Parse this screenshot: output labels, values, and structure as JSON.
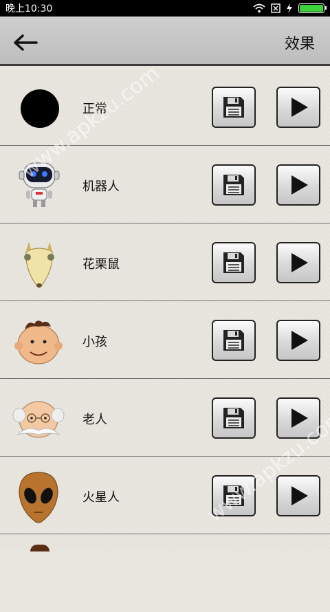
{
  "status_bar": {
    "time": "晚上10:30"
  },
  "toolbar": {
    "title": "效果"
  },
  "items": [
    {
      "label": "正常",
      "icon": "black-circle-icon"
    },
    {
      "label": "机器人",
      "icon": "robot-icon"
    },
    {
      "label": "花栗鼠",
      "icon": "chipmunk-icon"
    },
    {
      "label": "小孩",
      "icon": "child-face-icon"
    },
    {
      "label": "老人",
      "icon": "old-man-face-icon"
    },
    {
      "label": "火星人",
      "icon": "alien-face-icon"
    }
  ],
  "watermark": "www.apkzu.com",
  "colors": {
    "toolbar": "#c7c7c7",
    "background": "#e8e5de",
    "battery": "#3cd23c"
  }
}
